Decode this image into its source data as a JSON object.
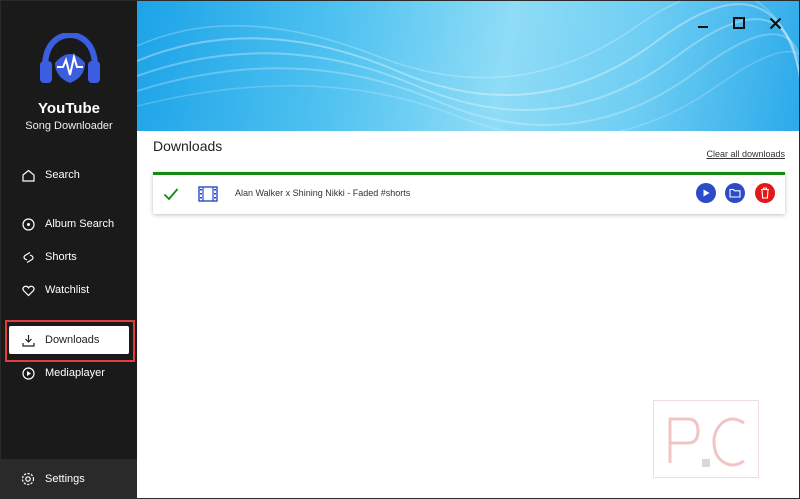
{
  "app": {
    "title": "YouTube",
    "subtitle": "Song Downloader"
  },
  "sidebar": {
    "items": [
      {
        "label": "Search",
        "icon": "home-icon"
      },
      {
        "label": "Album Search",
        "icon": "disc-icon"
      },
      {
        "label": "Shorts",
        "icon": "shorts-icon"
      },
      {
        "label": "Watchlist",
        "icon": "heart-icon"
      },
      {
        "label": "Downloads",
        "icon": "download-icon",
        "active": true
      },
      {
        "label": "Mediaplayer",
        "icon": "play-circle-icon"
      }
    ],
    "settings_label": "Settings"
  },
  "main": {
    "title": "Downloads",
    "clear_all_label": "Clear all downloads",
    "downloads": [
      {
        "title": "Alan Walker x Shining Nikki - Faded #shorts",
        "status": "complete"
      }
    ]
  },
  "colors": {
    "sidebar_bg": "#1a1a1a",
    "accent_blue": "#2b4bc8",
    "delete_red": "#e31818",
    "success_green": "#138a13",
    "highlight_red": "#e03d3d"
  }
}
